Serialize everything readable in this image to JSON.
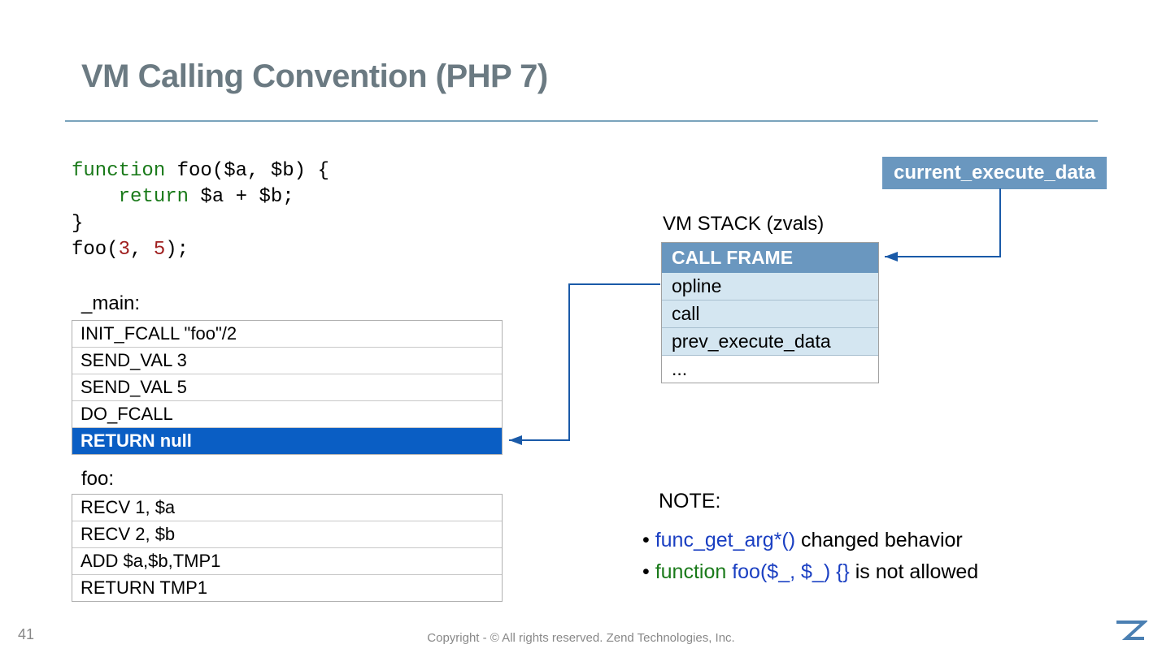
{
  "title": "VM Calling Convention (PHP 7)",
  "code": {
    "l1a": "function",
    "l1b": " foo($a, $b) {",
    "l2a": "    return",
    "l2b": " $a + $b;",
    "l3": "}",
    "l4a": "foo(",
    "l4b": "3",
    "l4c": ", ",
    "l4d": "5",
    "l4e": ");"
  },
  "main_label": "_main:",
  "main_rows": [
    "INIT_FCALL  \"foo\"/2",
    "SEND_VAL 3",
    "SEND_VAL 5",
    "DO_FCALL",
    "RETURN null"
  ],
  "main_highlight": 4,
  "foo_label": "foo:",
  "foo_rows": [
    "RECV 1, $a",
    "RECV 2, $b",
    "ADD $a,$b,TMP1",
    "RETURN TMP1"
  ],
  "ced": "current_execute_data",
  "vmstack": "VM STACK (zvals)",
  "callframe_head": "CALL FRAME",
  "callframe_rows": [
    "opline",
    "call",
    "prev_execute_data"
  ],
  "callframe_last": "...",
  "note_title": "NOTE:",
  "note1": {
    "a": "func_get_arg*()",
    "b": " changed behavior"
  },
  "note2": {
    "a": "function",
    "b": " foo(",
    "c": "$_, $_",
    "d": ") {} ",
    "e": "is not allowed"
  },
  "page": "41",
  "copyright": "Copyright - © All rights reserved. Zend Technologies, Inc."
}
